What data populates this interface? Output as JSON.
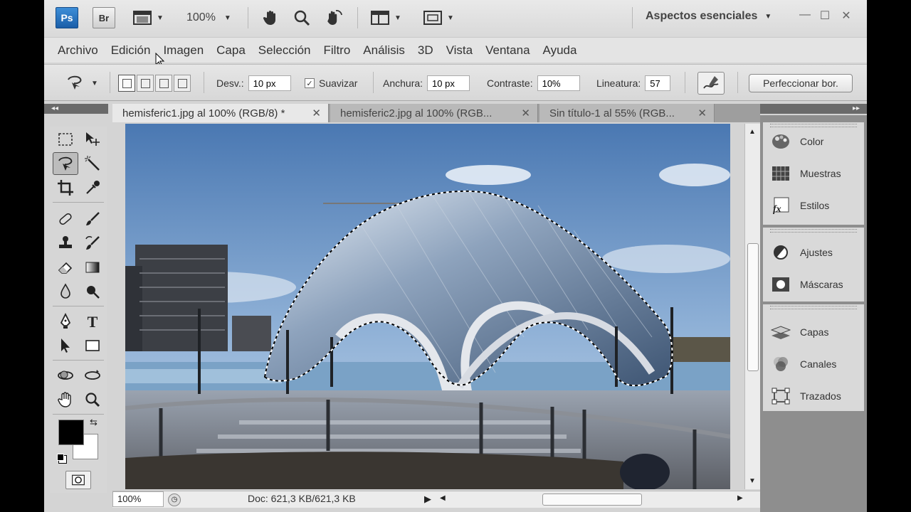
{
  "app_bar": {
    "ps_logo": "Ps",
    "br_logo": "Br",
    "zoom": "100%",
    "workspace": "Aspectos esenciales"
  },
  "menu": {
    "items": [
      "Archivo",
      "Edición",
      "Imagen",
      "Capa",
      "Selección",
      "Filtro",
      "Análisis",
      "3D",
      "Vista",
      "Ventana",
      "Ayuda"
    ]
  },
  "options": {
    "feather_label": "Desv.:",
    "feather_value": "10 px",
    "antialias_label": "Suavizar",
    "antialias_checked": true,
    "width_label": "Anchura:",
    "width_value": "10 px",
    "contrast_label": "Contraste:",
    "contrast_value": "10%",
    "frequency_label": "Lineatura:",
    "frequency_value": "57",
    "refine_button": "Perfeccionar bor."
  },
  "tabs": [
    {
      "label": "hemisferic1.jpg al 100% (RGB/8) *",
      "active": true
    },
    {
      "label": "hemisferic2.jpg al 100% (RGB...",
      "active": false
    },
    {
      "label": "Sin título-1 al 55% (RGB...",
      "active": false
    }
  ],
  "status": {
    "zoom": "100%",
    "doc": "Doc: 621,3 KB/621,3 KB"
  },
  "panels": {
    "group1": [
      "Color",
      "Muestras",
      "Estilos"
    ],
    "group2": [
      "Ajustes",
      "Máscaras"
    ],
    "group3": [
      "Capas",
      "Canales",
      "Trazados"
    ]
  },
  "colors": {
    "foreground": "#000000",
    "background": "#ffffff",
    "ps_blue": "#2a72c0"
  },
  "icons": {
    "toolbox": [
      "marquee-icon",
      "move-icon",
      "magnetic-lasso-icon",
      "magic-wand-icon",
      "crop-icon",
      "eyedropper-icon",
      "healing-brush-icon",
      "brush-icon",
      "clone-stamp-icon",
      "history-brush-icon",
      "eraser-icon",
      "gradient-icon",
      "blur-icon",
      "dodge-icon",
      "pen-icon",
      "type-icon",
      "path-select-icon",
      "rectangle-icon",
      "3d-rotate-icon",
      "3d-orbit-icon",
      "hand-icon",
      "zoom-icon",
      "quick-mask-icon"
    ]
  }
}
